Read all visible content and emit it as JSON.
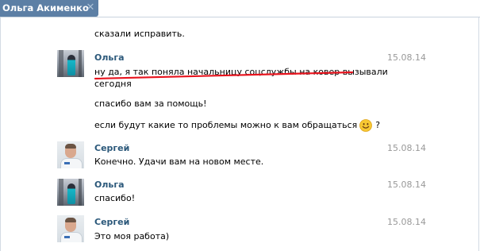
{
  "window": {
    "tab_title": "Ольга Акименко",
    "close_icon": "close-icon"
  },
  "messages": {
    "prev_tail": "сказали исправить.",
    "olga_1": {
      "author": "Ольга",
      "date": "15.08.14",
      "line1": "ну да, я так поняла начальницу соцслужбы на ковер вызывали",
      "line2": "сегодня",
      "line3": "спасибо вам за помощь!",
      "line4": "если будут какие то проблемы можно к вам обращаться",
      "line4_emoji": "smiley-emoji",
      "line4_end": "?"
    },
    "sergey_1": {
      "author": "Сергей",
      "date": "15.08.14",
      "text": "Конечно. Удачи вам на новом месте."
    },
    "olga_2": {
      "author": "Ольга",
      "date": "15.08.14",
      "text": "спасибо!"
    },
    "sergey_2": {
      "author": "Сергей",
      "date": "15.08.14",
      "text": "Это моя работа)"
    }
  },
  "annotation": {
    "underline_color": "#e8141e"
  },
  "colors": {
    "tab_bg": "#5c7fa5",
    "author": "#2b587a",
    "date": "#999999"
  }
}
